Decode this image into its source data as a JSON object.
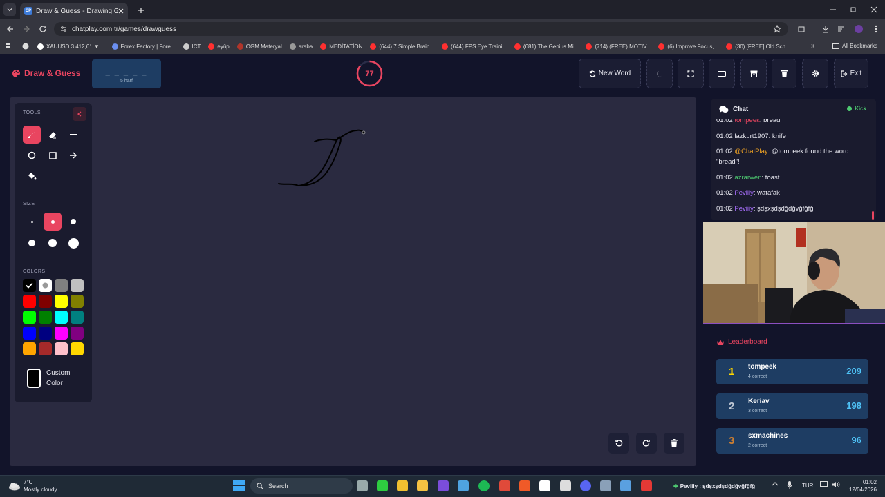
{
  "browser": {
    "tab_title": "Draw & Guess - Drawing Game",
    "tab_favicon": "CP",
    "url": "chatplay.com.tr/games/drawguess",
    "bookmarks": [
      {
        "label": "XAUUSD 3.412,61 ▼...",
        "color": "#ffffff"
      },
      {
        "label": "Forex Factory | Fore...",
        "color": "#6b8ff0"
      },
      {
        "label": "ICT",
        "color": "#cccccc"
      },
      {
        "label": "eyüp",
        "color": "#ff3030"
      },
      {
        "label": "OGM Materyal",
        "color": "#b0352a"
      },
      {
        "label": "araba",
        "color": "#999999"
      },
      {
        "label": "MEDİTATİON",
        "color": "#ff3030"
      },
      {
        "label": "(644) 7 Simple Brain...",
        "color": "#ff3030"
      },
      {
        "label": "(644) FPS Eye Traini...",
        "color": "#ff3030"
      },
      {
        "label": "(681) The Genius Mi...",
        "color": "#ff3030"
      },
      {
        "label": "(714) (FREE) MOTIV...",
        "color": "#ff3030"
      },
      {
        "label": "(6) Improve Focus,...",
        "color": "#ff3030"
      },
      {
        "label": "(30) [FREE] Old Sch...",
        "color": "#ff3030"
      }
    ],
    "all_bookmarks": "All Bookmarks"
  },
  "header": {
    "logo": "Draw & Guess",
    "word_mask": "_ _ _ _ _",
    "word_hint": "5 harf",
    "timer": "77",
    "timer_progress": 0.86,
    "new_word": "New Word",
    "exit": "Exit"
  },
  "tools": {
    "tools_label": "TOOLS",
    "size_label": "SIZE",
    "colors_label": "COLORS",
    "custom_color": "Custom Color",
    "selected_tool": "pen",
    "selected_size": 2,
    "colors": [
      "#000000",
      "#ffffff",
      "#808080",
      "#c0c0c0",
      "#ff0000",
      "#800000",
      "#ffff00",
      "#808000",
      "#00ff00",
      "#008000",
      "#00ffff",
      "#008080",
      "#0000ff",
      "#000080",
      "#ff00ff",
      "#800080",
      "#ffa500",
      "#a52a2a",
      "#ffc0cb",
      "#ffd700"
    ],
    "accent": "#e94560"
  },
  "chat": {
    "title": "Chat",
    "kick_label": "Kick",
    "messages": [
      {
        "time": "01:02",
        "user": "tompeek",
        "user_color": "#e94560",
        "text": "bread"
      },
      {
        "time": "01:02",
        "user": "lazkurt1907",
        "user_color": "#e8e8f0",
        "text": "knife"
      },
      {
        "time": "01:02",
        "user": "@ChatPlay",
        "user_color": "#f5a623",
        "text": "@tompeek found the word \"bread\"!"
      },
      {
        "time": "01:02",
        "user": "azrarwen",
        "user_color": "#4ecb71",
        "text": "toast"
      },
      {
        "time": "01:02",
        "user": "Peviiiy",
        "user_color": "#a970ff",
        "text": "watafak"
      },
      {
        "time": "01:02",
        "user": "Peviiiy",
        "user_color": "#a970ff",
        "text": "şdşxşdşdğdğvğfğfğ"
      }
    ]
  },
  "leaderboard": {
    "title": "Leaderboard",
    "entries": [
      {
        "rank": "1",
        "name": "tompeek",
        "correct": "4 correct",
        "score": "209",
        "rank_color": "#ffd700"
      },
      {
        "rank": "2",
        "name": "Keriav",
        "correct": "3 correct",
        "score": "198",
        "rank_color": "#c0c8d4"
      },
      {
        "rank": "3",
        "name": "sxmachines",
        "correct": "2 correct",
        "score": "96",
        "rank_color": "#cd7f32"
      }
    ]
  },
  "taskbar": {
    "weather_temp": "7°C",
    "weather_desc": "Mostly cloudy",
    "search": "Search",
    "notification": "Peviiiy : şdşxşdşdğdğvğfğfğ",
    "lang": "TUR",
    "time": "01:02",
    "date": "12/04/2026"
  }
}
